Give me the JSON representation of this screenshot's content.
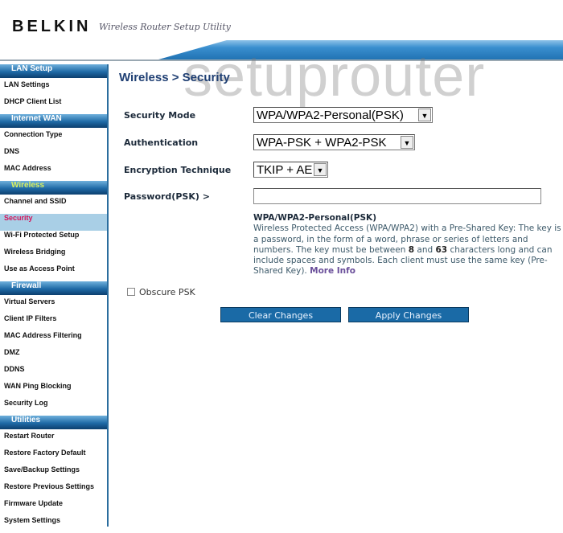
{
  "header": {
    "brand": "BELKIN",
    "subtitle": "Wireless Router Setup Utility",
    "watermark": "setuprouter"
  },
  "sidebar": {
    "sections": [
      {
        "label": "LAN Setup",
        "items": [
          "LAN Settings",
          "DHCP Client List"
        ]
      },
      {
        "label": "Internet WAN",
        "items": [
          "Connection Type",
          "DNS",
          "MAC Address"
        ]
      },
      {
        "label": "Wireless",
        "active": true,
        "items": [
          "Channel and SSID",
          "Security",
          "Wi-Fi Protected Setup",
          "Wireless Bridging",
          "Use as Access Point"
        ]
      },
      {
        "label": "Firewall",
        "items": [
          "Virtual Servers",
          "Client IP Filters",
          "MAC Address Filtering",
          "DMZ",
          "DDNS",
          "WAN Ping Blocking",
          "Security Log"
        ]
      },
      {
        "label": "Utilities",
        "items": [
          "Restart Router",
          "Restore Factory Default",
          "Save/Backup Settings",
          "Restore Previous Settings",
          "Firmware Update",
          "System Settings"
        ]
      }
    ],
    "active_item": "Security"
  },
  "main": {
    "title": "Wireless > Security",
    "security_mode": {
      "label": "Security Mode",
      "value": "WPA/WPA2-Personal(PSK)"
    },
    "authentication": {
      "label": "Authentication",
      "value": "WPA-PSK + WPA2-PSK"
    },
    "encryption": {
      "label": "Encryption Technique",
      "value": "TKIP + AES"
    },
    "password": {
      "label": "Password(PSK) >",
      "value": ""
    },
    "info": {
      "title": "WPA/WPA2-Personal(PSK)",
      "text1": "Wireless Protected Access (WPA/WPA2) with a Pre-Shared Key: The key is a password, in the form of a word, phrase or series of letters and numbers. The key must be between ",
      "min": "8",
      "and": " and ",
      "max": "63",
      "text2": " characters long and can include spaces and symbols. Each client must use the same key (Pre-Shared Key). ",
      "more_info": "More Info"
    },
    "obscure_psk": {
      "label": "Obscure PSK",
      "checked": false
    },
    "clear_button": "Clear Changes",
    "apply_button": "Apply Changes"
  }
}
